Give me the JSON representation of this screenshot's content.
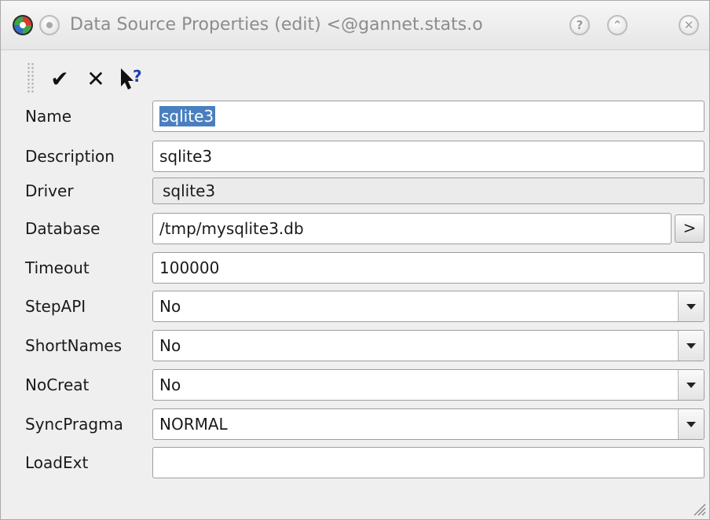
{
  "window": {
    "title": "Data Source Properties (edit) <@gannet.stats.o",
    "help_symbol": "?",
    "shade_symbol": "⌃",
    "close_symbol": "✕"
  },
  "toolbar": {
    "ok_symbol": "✔",
    "cancel_symbol": "✕",
    "whats_this_symbol": "?"
  },
  "form": {
    "name": {
      "label": "Name",
      "value": "sqlite3"
    },
    "description": {
      "label": "Description",
      "value": "sqlite3"
    },
    "driver": {
      "label": "Driver",
      "value": "sqlite3"
    },
    "database": {
      "label": "Database",
      "value": "/tmp/mysqlite3.db",
      "browse_label": ">"
    },
    "timeout": {
      "label": "Timeout",
      "value": "100000"
    },
    "stepapi": {
      "label": "StepAPI",
      "value": "No"
    },
    "shortnames": {
      "label": "ShortNames",
      "value": "No"
    },
    "nocreat": {
      "label": "NoCreat",
      "value": "No"
    },
    "syncpragma": {
      "label": "SyncPragma",
      "value": "NORMAL"
    },
    "loadext": {
      "label": "LoadExt",
      "value": ""
    }
  }
}
